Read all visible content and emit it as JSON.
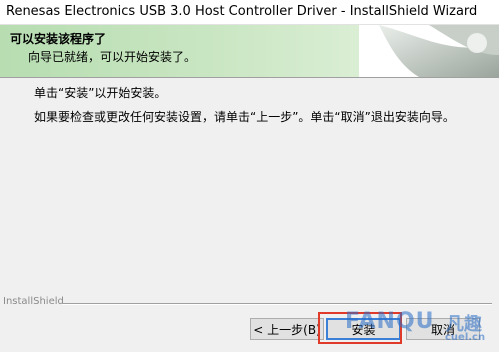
{
  "window": {
    "title": "Renesas Electronics USB 3.0 Host Controller Driver - InstallShield Wizard"
  },
  "banner": {
    "heading": "可以安装该程序了",
    "subheading": "向导已就绪，可以开始安装了。"
  },
  "body": {
    "line1": "单击“安装”以开始安装。",
    "line2": "如果要检查或更改任何安装设置，请单击“上一步”。单击“取消”退出安装向导。"
  },
  "footer": {
    "brand": "InstallShield"
  },
  "buttons": {
    "back": "< 上一步(B)",
    "install": "安装",
    "cancel": "取消"
  },
  "watermark": {
    "text": "FANQU",
    "cn": "凡趣",
    "domain": "cuel.cn"
  },
  "colors": {
    "banner_green": "#c9e6c2",
    "highlight_red": "#e03a2a",
    "default_button_blue": "#3c7fd6"
  }
}
